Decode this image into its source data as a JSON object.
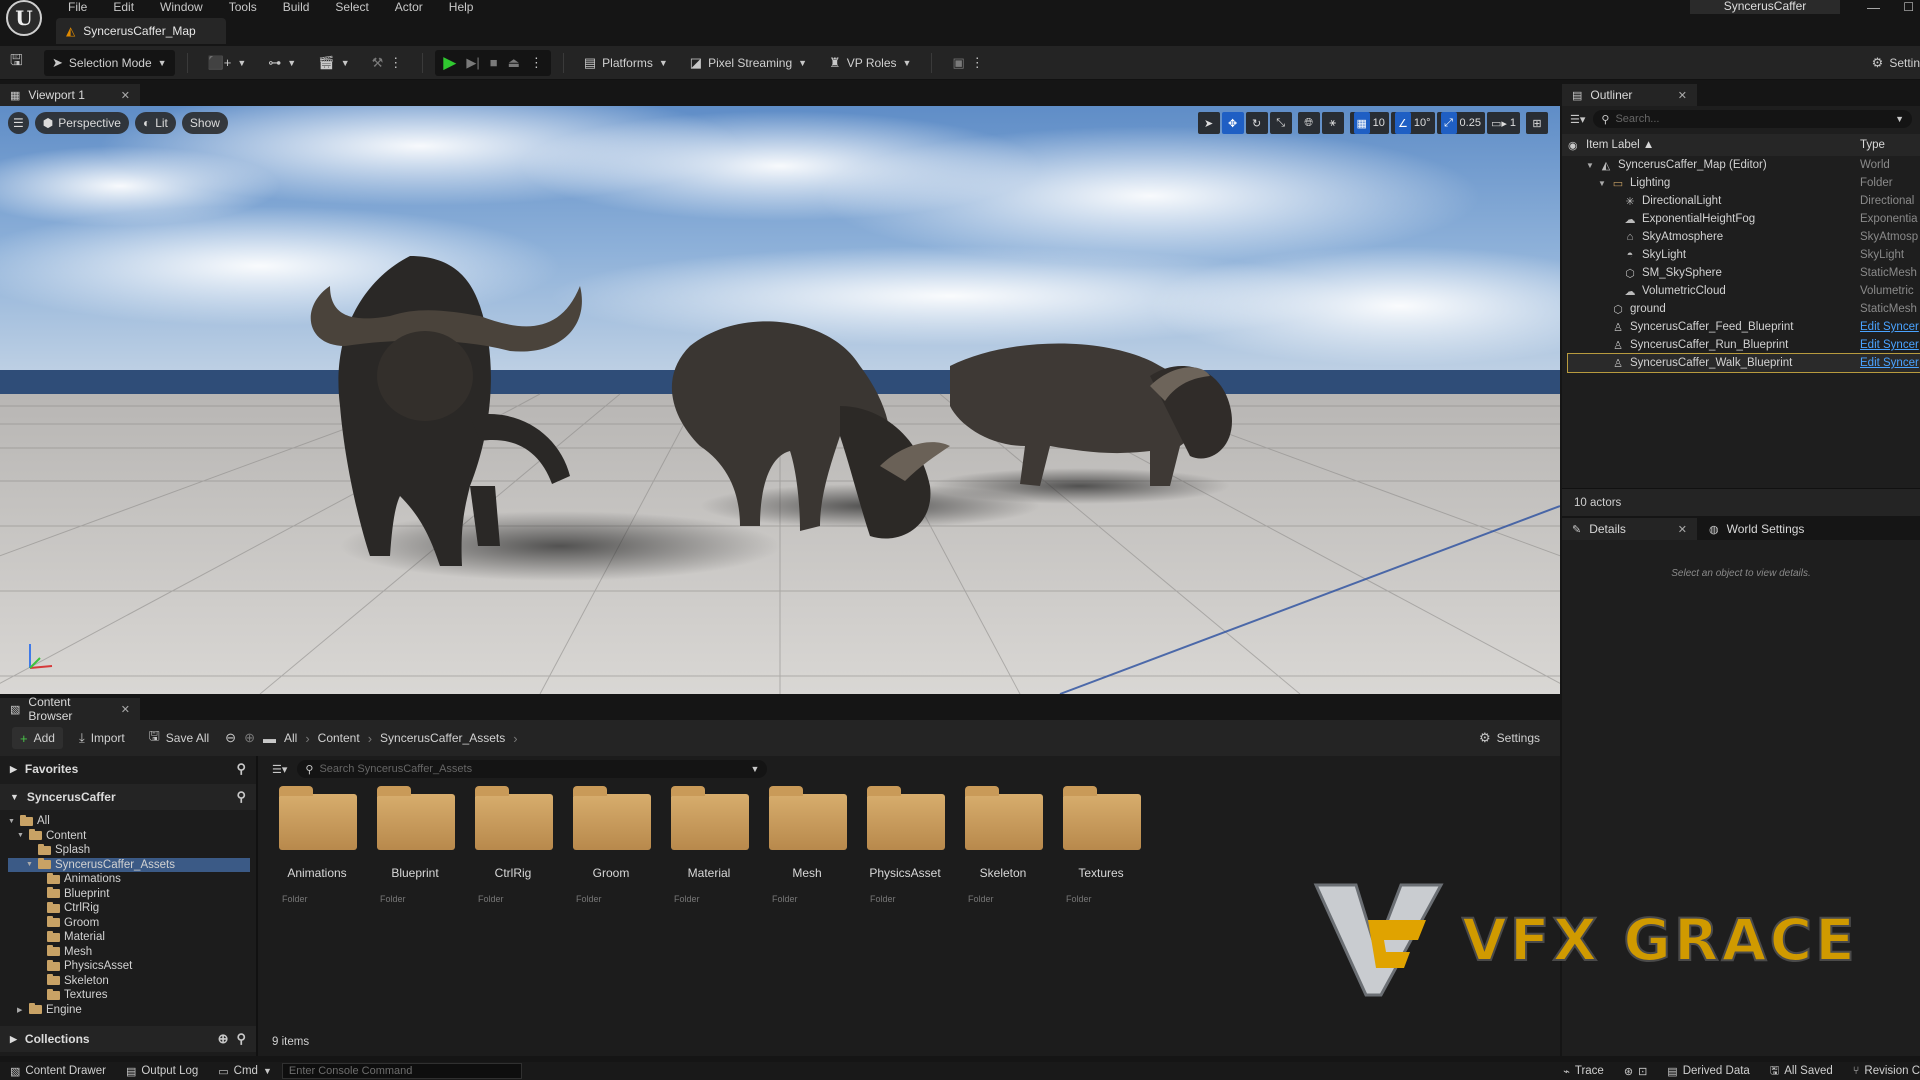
{
  "app": {
    "menu": [
      "File",
      "Edit",
      "Window",
      "Tools",
      "Build",
      "Select",
      "Actor",
      "Help"
    ],
    "map_tab": "SyncerusCaffer_Map",
    "project_name": "SyncerusCaffer",
    "logo_letter": "U"
  },
  "toolbar": {
    "selection_mode": "Selection Mode",
    "platforms": "Platforms",
    "pixel_streaming": "Pixel Streaming",
    "vp_roles": "VP Roles",
    "settings": "Settin"
  },
  "viewport": {
    "tab": "Viewport 1",
    "perspective": "Perspective",
    "lit": "Lit",
    "show": "Show",
    "grid_snap": "10",
    "rotation_snap": "10°",
    "scale_snap": "0.25",
    "camera_speed": "1"
  },
  "outliner": {
    "tab": "Outliner",
    "search_placeholder": "Search...",
    "col_label": "Item Label ▲",
    "col_type": "Type",
    "rows": [
      {
        "label": "SyncerusCaffer_Map (Editor)",
        "type": "World",
        "indent": 0,
        "icon": "world-icon",
        "glyph": "◭",
        "arrow": "▼"
      },
      {
        "label": "Lighting",
        "type": "Folder",
        "indent": 1,
        "icon": "folder-icon",
        "glyph": "▭",
        "arrow": "▼"
      },
      {
        "label": "DirectionalLight",
        "type": "Directional",
        "indent": 2,
        "icon": "sun-icon",
        "glyph": "✳",
        "arrow": ""
      },
      {
        "label": "ExponentialHeightFog",
        "type": "Exponentia",
        "indent": 2,
        "icon": "fog-icon",
        "glyph": "☁",
        "arrow": ""
      },
      {
        "label": "SkyAtmosphere",
        "type": "SkyAtmosp",
        "indent": 2,
        "icon": "atmosphere-icon",
        "glyph": "⌂",
        "arrow": ""
      },
      {
        "label": "SkyLight",
        "type": "SkyLight",
        "indent": 2,
        "icon": "skylight-icon",
        "glyph": "◓",
        "arrow": ""
      },
      {
        "label": "SM_SkySphere",
        "type": "StaticMesh",
        "indent": 2,
        "icon": "mesh-icon",
        "glyph": "⬡",
        "arrow": ""
      },
      {
        "label": "VolumetricCloud",
        "type": "Volumetric",
        "indent": 2,
        "icon": "cloud-icon",
        "glyph": "☁",
        "arrow": ""
      },
      {
        "label": "ground",
        "type": "StaticMesh",
        "indent": 1,
        "icon": "mesh-icon",
        "glyph": "⬡",
        "arrow": ""
      },
      {
        "label": "SyncerusCaffer_Feed_Blueprint",
        "type": "Edit Syncer",
        "indent": 1,
        "icon": "actor-icon",
        "glyph": "♙",
        "arrow": "",
        "link": true
      },
      {
        "label": "SyncerusCaffer_Run_Blueprint",
        "type": "Edit Syncer",
        "indent": 1,
        "icon": "actor-icon",
        "glyph": "♙",
        "arrow": "",
        "link": true
      },
      {
        "label": "SyncerusCaffer_Walk_Blueprint",
        "type": "Edit Syncer",
        "indent": 1,
        "icon": "actor-icon",
        "glyph": "♙",
        "arrow": "",
        "link": true,
        "selected": true
      }
    ],
    "actor_count": "10 actors"
  },
  "details": {
    "tab": "Details",
    "world_settings_tab": "World Settings",
    "empty_message": "Select an object to view details."
  },
  "content_browser": {
    "tab": "Content Browser",
    "add": "Add",
    "import": "Import",
    "save_all": "Save All",
    "breadcrumb": [
      "All",
      "Content",
      "SyncerusCaffer_Assets"
    ],
    "settings": "Settings",
    "favorites": "Favorites",
    "project": "SyncerusCaffer",
    "collections": "Collections",
    "search_placeholder": "Search SyncerusCaffer_Assets",
    "tree": [
      {
        "label": "All",
        "indent": 0,
        "arrow": "▼"
      },
      {
        "label": "Content",
        "indent": 1,
        "arrow": "▼"
      },
      {
        "label": "Splash",
        "indent": 2,
        "arrow": ""
      },
      {
        "label": "SyncerusCaffer_Assets",
        "indent": 2,
        "arrow": "▼",
        "selected": true
      },
      {
        "label": "Animations",
        "indent": 3,
        "arrow": ""
      },
      {
        "label": "Blueprint",
        "indent": 3,
        "arrow": ""
      },
      {
        "label": "CtrlRig",
        "indent": 3,
        "arrow": ""
      },
      {
        "label": "Groom",
        "indent": 3,
        "arrow": ""
      },
      {
        "label": "Material",
        "indent": 3,
        "arrow": ""
      },
      {
        "label": "Mesh",
        "indent": 3,
        "arrow": ""
      },
      {
        "label": "PhysicsAsset",
        "indent": 3,
        "arrow": ""
      },
      {
        "label": "Skeleton",
        "indent": 3,
        "arrow": ""
      },
      {
        "label": "Textures",
        "indent": 3,
        "arrow": ""
      },
      {
        "label": "Engine",
        "indent": 1,
        "arrow": "▶"
      }
    ],
    "folders": [
      {
        "name": "Animations",
        "type": "Folder"
      },
      {
        "name": "Blueprint",
        "type": "Folder"
      },
      {
        "name": "CtrlRig",
        "type": "Folder"
      },
      {
        "name": "Groom",
        "type": "Folder"
      },
      {
        "name": "Material",
        "type": "Folder"
      },
      {
        "name": "Mesh",
        "type": "Folder"
      },
      {
        "name": "PhysicsAsset",
        "type": "Folder"
      },
      {
        "name": "Skeleton",
        "type": "Folder"
      },
      {
        "name": "Textures",
        "type": "Folder"
      }
    ],
    "item_count": "9 items"
  },
  "watermark": {
    "text": "VFX GRACE"
  },
  "statusbar": {
    "content_drawer": "Content Drawer",
    "output_log": "Output Log",
    "cmd": "Cmd",
    "console_placeholder": "Enter Console Command",
    "trace": "Trace",
    "derived_data": "Derived Data",
    "all_saved": "All Saved",
    "revision": "Revision C"
  }
}
